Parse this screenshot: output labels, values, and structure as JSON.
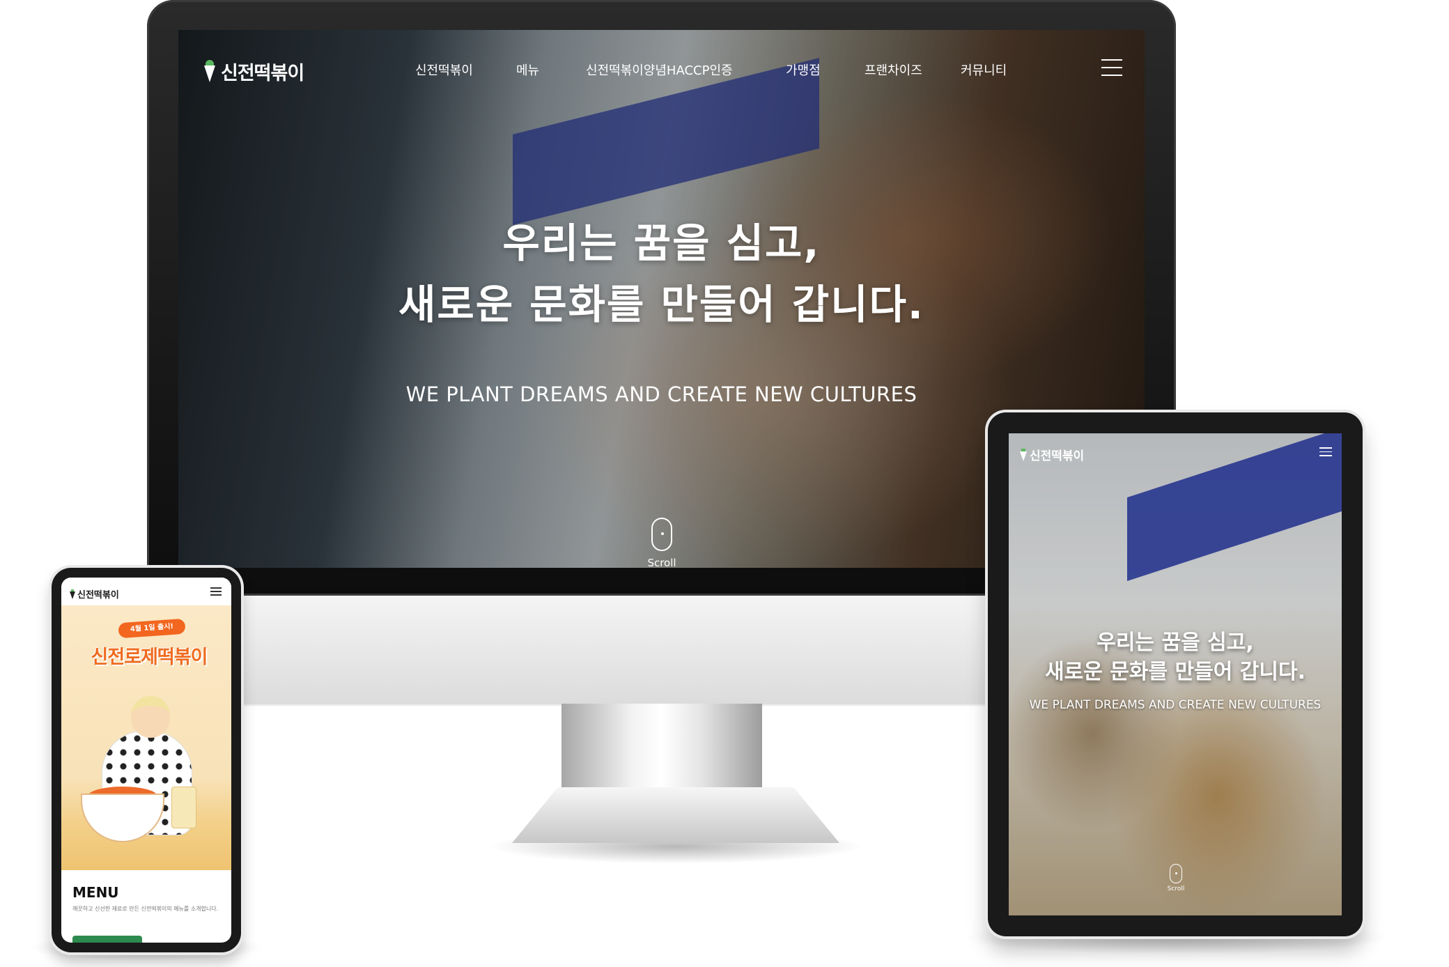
{
  "brand": {
    "name": "신전떡볶이",
    "accent_color": "#5ab85c",
    "logo_icon": "carrot-logo-icon"
  },
  "desktop": {
    "nav": {
      "items": [
        {
          "label": "신전떡볶이"
        },
        {
          "label": "메뉴"
        },
        {
          "label": "신전떡볶이양념HACCP인증"
        },
        {
          "label": "가맹점"
        },
        {
          "label": "프랜차이즈"
        },
        {
          "label": "커뮤니티"
        }
      ],
      "menu_icon": "hamburger-menu-icon"
    },
    "hero": {
      "title_line1": "우리는 꿈을 심고,",
      "title_line2": "새로운 문화를 만들어 갑니다.",
      "subtitle": "WE PLANT DREAMS AND CREATE NEW CULTURES",
      "scroll_label": "Scroll"
    }
  },
  "tablet": {
    "hero": {
      "title_line1": "우리는 꿈을 심고,",
      "title_line2": "새로운 문화를 만들어 갑니다.",
      "subtitle": "WE PLANT DREAMS AND CREATE NEW CULTURES",
      "scroll_label": "Scroll"
    }
  },
  "mobile": {
    "banner": {
      "badge": "4월 1일 출시!",
      "product_name": "신전로제떡볶이",
      "accent_color": "#ef6b1f"
    },
    "menu_section": {
      "title": "MENU",
      "description": "깨끗하고 신선한 재료로 만든 신전떡볶이의 메뉴를 소개합니다."
    }
  }
}
